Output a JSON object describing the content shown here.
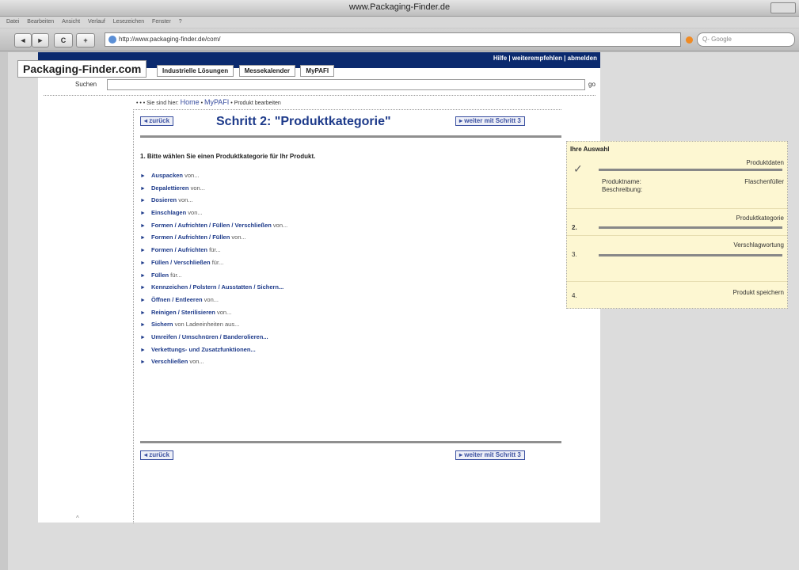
{
  "window": {
    "title": "www.Packaging-Finder.de"
  },
  "menu": [
    "Datei",
    "Bearbeiten",
    "Ansicht",
    "Verlauf",
    "Lesezeichen",
    "Fenster",
    "?"
  ],
  "nav": {
    "back": "◄",
    "forward": "►",
    "reload": "C",
    "add": "+",
    "url": "http://www.packaging-finder.de/com/",
    "search_placeholder": "Q- Google"
  },
  "site": {
    "logo": "Packaging-Finder.com",
    "top_links": "Hilfe | weiterempfehlen | abmelden",
    "tabs": [
      "Industrielle Lösungen",
      "Messekalender",
      "MyPAFI"
    ],
    "search_label": "Suchen",
    "search_go": "go"
  },
  "breadcrumb": {
    "prefix": "• • • Sie sind hier:",
    "home": "Home",
    "sep1": " • ",
    "mypafi": "MyPAFI",
    "sep2": " • ",
    "current": "Produkt bearbeiten"
  },
  "step": {
    "back": "◂ zurück",
    "title": "Schritt 2: \"Produktkategorie\"",
    "next": "▸ weiter mit Schritt 3"
  },
  "prompt": "1. Bitte wählen Sie einen Produktkategorie für Ihr Produkt.",
  "categories": [
    {
      "bold": "Auspacken",
      "rest": " von..."
    },
    {
      "bold": "Depalettieren",
      "rest": " von..."
    },
    {
      "bold": "Dosieren",
      "rest": " von..."
    },
    {
      "bold": "Einschlagen",
      "rest": " von..."
    },
    {
      "bold": "Formen / Aufrichten / Füllen / Verschließen",
      "rest": " von..."
    },
    {
      "bold": "Formen / Aufrichten / Füllen",
      "rest": " von..."
    },
    {
      "bold": "Formen / Aufrichten",
      "rest": " für..."
    },
    {
      "bold": "Füllen / Verschließen",
      "rest": " für..."
    },
    {
      "bold": "Füllen",
      "rest": " für..."
    },
    {
      "bold": "Kennzeichen / Polstern / Ausstatten / Sichern...",
      "rest": ""
    },
    {
      "bold": "Öffnen / Entleeren",
      "rest": " von..."
    },
    {
      "bold": "Reinigen / Sterilisieren",
      "rest": " von..."
    },
    {
      "bold": "Sichern",
      "rest": " von Ladeeinheiten aus..."
    },
    {
      "bold": "Umreifen / Umschnüren / Banderolieren...",
      "rest": ""
    },
    {
      "bold": "Verkettungs- und Zusatzfunktionen...",
      "rest": ""
    },
    {
      "bold": "Verschließen",
      "rest": " von..."
    }
  ],
  "selection": {
    "heading": "Ihre Auswahl",
    "s1_label": "Produktdaten",
    "s1_k1": "Produktname:",
    "s1_k2": "Beschreibung:",
    "s1_v1": "Flaschenfüller",
    "s2_num": "2.",
    "s2_label": "Produktkategorie",
    "s3_num": "3.",
    "s3_label": "Verschlagwortung",
    "s4_num": "4.",
    "s4_label": "Produkt speichern"
  },
  "footer_mark": "^"
}
